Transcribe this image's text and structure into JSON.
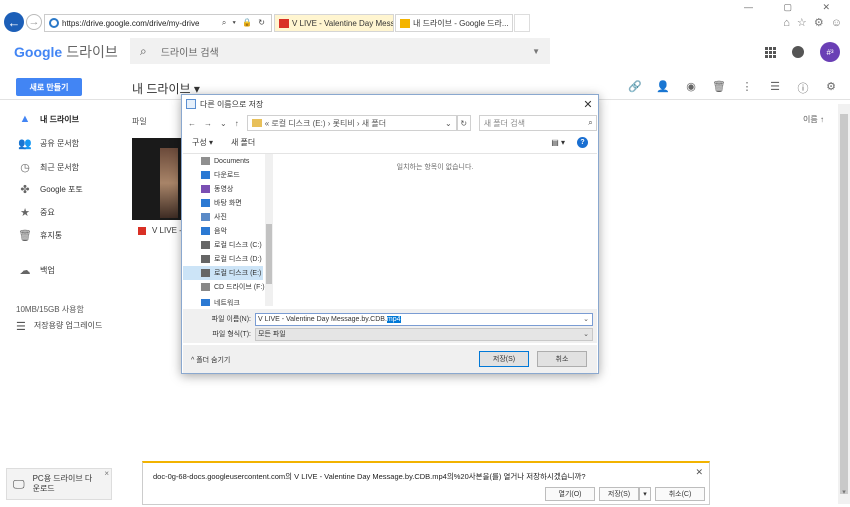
{
  "browser": {
    "url": "https://drive.google.com/drive/my-drive",
    "addr_icons": "⌕ ▾ 🔒 ↻",
    "tabs": [
      {
        "label": "V LIVE - Valentine Day Messa..."
      },
      {
        "label": "내 드라이브 - Google 드라..."
      }
    ],
    "win_controls": "—  ▢  ✕",
    "right_icons": "⌂ ☆ ⚙ ☺"
  },
  "drive": {
    "logo": "Google",
    "logo_drive": "드라이브",
    "search_placeholder": "드라이브 검색",
    "avatar_text": "#³",
    "new_button": "새로 만들기",
    "title": "내 드라이브",
    "sidebar": [
      {
        "label": "내 드라이브",
        "icon": "▲"
      },
      {
        "label": "공유 문서함",
        "icon": "👥"
      },
      {
        "label": "최근 문서함",
        "icon": "◷"
      },
      {
        "label": "Google 포토",
        "icon": "✤"
      },
      {
        "label": "중요",
        "icon": "★"
      },
      {
        "label": "휴지통",
        "icon": "🗑"
      },
      {
        "label": "백업",
        "icon": "☁"
      }
    ],
    "storage": "10MB/15GB 사용함",
    "upgrade": "저장용량 업그레이드",
    "files_label": "파일",
    "sort_label": "이름   ↑",
    "file_name": "V LIVE -",
    "pc_promo": "PC용 드라이브 다운로드"
  },
  "dialog": {
    "title": "다른 이름으로 저장",
    "path": "«  로컬 디스크 (E:)  ›  롯티비  ›  새 폴더",
    "search_placeholder": "새 폴더 검색",
    "organize": "구성 ▾",
    "new_folder": "새 폴더",
    "empty_message": "일치하는 항목이 없습니다.",
    "tree": [
      {
        "label": "Documents",
        "color": "#8f8f8f"
      },
      {
        "label": "다운로드",
        "color": "#2b79d3"
      },
      {
        "label": "동영상",
        "color": "#7a4fb3"
      },
      {
        "label": "바탕 화면",
        "color": "#2b79d3"
      },
      {
        "label": "사진",
        "color": "#5a8ac7"
      },
      {
        "label": "음악",
        "color": "#2b79d3"
      },
      {
        "label": "로컬 디스크 (C:)",
        "color": "#666666"
      },
      {
        "label": "로컬 디스크 (D:)",
        "color": "#666666"
      },
      {
        "label": "로컬 디스크 (E:)",
        "color": "#666666"
      },
      {
        "label": "CD 드라이브 (F:)",
        "color": "#888888"
      },
      {
        "label": "네트워크",
        "color": "#2b79d3"
      }
    ],
    "filename_label": "파일 이름(N):",
    "filename_value": "V LIVE - Valentine Day Message.by.CDB.",
    "filename_ext": "mp4",
    "filetype_label": "파일 형식(T):",
    "filetype_value": "모든 파일",
    "hide_folders": "^  폴더 숨기기",
    "save": "저장(S)",
    "cancel": "취소"
  },
  "download": {
    "message": "doc-0g-68-docs.googleusercontent.com의 V LIVE - Valentine Day Message.by.CDB.mp4의%20사본을(를) 열거나 저장하시겠습니까?",
    "open": "열기(O)",
    "save": "저장(S)",
    "cancel": "취소(C)"
  },
  "colors": {
    "accent": "#4285f4",
    "ie_blue": "#1c5fb8",
    "dialog_border": "#8aa8cf",
    "download_bar": "#f2b300"
  }
}
